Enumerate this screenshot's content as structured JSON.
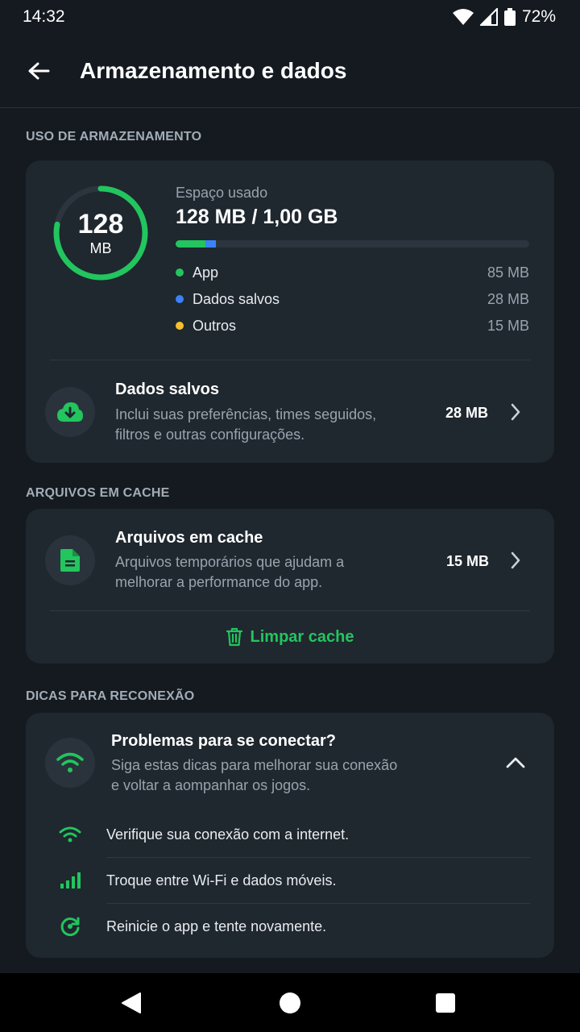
{
  "status_bar": {
    "time": "14:32",
    "battery": "72%"
  },
  "app_bar": {
    "title": "Armazenamento e dados"
  },
  "storage": {
    "section_label": "USO DE ARMAZENAMENTO",
    "ring_value": "128",
    "ring_unit": "MB",
    "used_label": "Espaço usado",
    "used_value": "128 MB / 1,00 GB",
    "usage_fraction": 0.125,
    "legend": [
      {
        "name": "App",
        "size": "85 MB",
        "color": "#22c55e",
        "mb": 85
      },
      {
        "name": "Dados salvos",
        "size": "28 MB",
        "color": "#3b82f6",
        "mb": 28
      },
      {
        "name": "Outros",
        "size": "15 MB",
        "color": "#f5c02c",
        "mb": 15
      }
    ],
    "saved_data": {
      "title": "Dados salvos",
      "desc_line1": "Inclui suas preferências, times seguidos,",
      "desc_line2": "filtros e outras configurações.",
      "size": "28 MB"
    }
  },
  "cache": {
    "section_label": "ARQUIVOS EM CACHE",
    "title": "Arquivos em cache",
    "desc_line1": "Arquivos temporários que ajudam a",
    "desc_line2": "melhorar a performance do app.",
    "size": "15 MB",
    "clear_label": "Limpar cache"
  },
  "tips": {
    "section_label": "DICAS PARA RECONEXÃO",
    "title": "Problemas para se conectar?",
    "desc_line1": "Siga estas dicas para melhorar sua conexão",
    "desc_line2": "e voltar a aompanhar os jogos.",
    "items": [
      {
        "text": "Verifique sua conexão com a internet.",
        "icon": "wifi-icon"
      },
      {
        "text": "Troque entre Wi-Fi e dados móveis.",
        "icon": "signal-bars-icon"
      },
      {
        "text": "Reinicie o app e tente novamente.",
        "icon": "restart-icon"
      }
    ]
  },
  "colors": {
    "accent": "#22c55e",
    "background": "#141a20",
    "card": "#1f272f"
  }
}
